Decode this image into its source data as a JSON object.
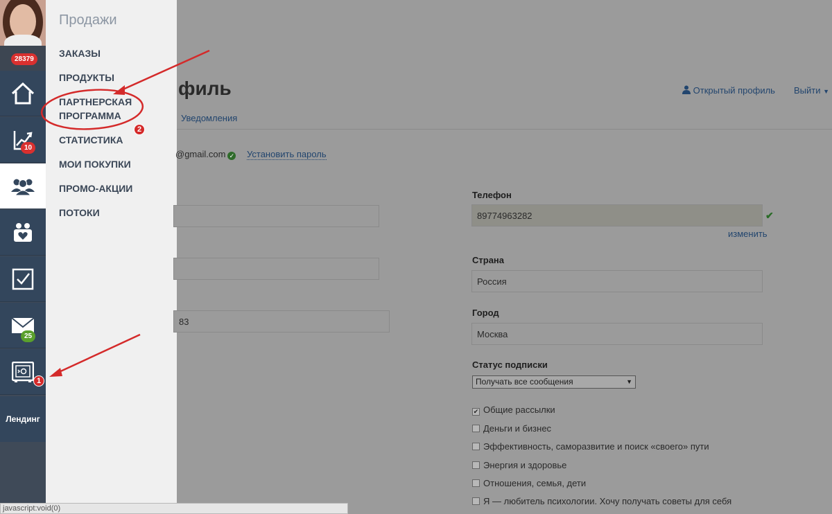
{
  "rail": {
    "notifications_count": "28379",
    "stats_badge": "10",
    "mail_badge": "25",
    "landing_label": "Лендинг"
  },
  "flyout": {
    "title": "Продажи",
    "items": [
      {
        "label": "ЗАКАЗЫ"
      },
      {
        "label": "ПРОДУКТЫ"
      },
      {
        "label": "ПАРТНЕРСКАЯ\nПРОГРАММА"
      },
      {
        "label": "СТАТИСТИКА"
      },
      {
        "label": "МОИ ПОКУПКИ"
      },
      {
        "label": "ПРОМО-АКЦИИ"
      },
      {
        "label": "ПОТОКИ"
      }
    ]
  },
  "header": {
    "title_fragment": "филь",
    "open_profile": "Открытый профиль",
    "logout": "Выйти"
  },
  "tabs": {
    "notifications": "Уведомления"
  },
  "account": {
    "email_fragment": "@gmail.com",
    "set_password": "Установить пароль"
  },
  "form": {
    "left_field_3_fragment": "83",
    "phone_label": "Телефон",
    "phone_value": "89774963282",
    "change_link": "изменить",
    "country_label": "Страна",
    "country_value": "Россия",
    "city_label": "Город",
    "city_value": "Москва",
    "subscription_label": "Статус подписки",
    "subscription_selected": "Получать все сообщения",
    "checkboxes": [
      {
        "label": "Общие рассылки",
        "checked": true
      },
      {
        "label": "Деньги и бизнес",
        "checked": false
      },
      {
        "label": "Эффективность, саморазвитие и поиск «своего» пути",
        "checked": false
      },
      {
        "label": "Энергия и здоровье",
        "checked": false
      },
      {
        "label": "Отношения, семья, дети",
        "checked": false
      },
      {
        "label": "Я — любитель психологии. Хочу получать советы для себя",
        "checked": false
      }
    ]
  },
  "statusbar": {
    "text": "javascript:void(0)"
  },
  "annotations": {
    "marker_1": "1",
    "marker_2": "2",
    "color": "#d42a2a"
  }
}
